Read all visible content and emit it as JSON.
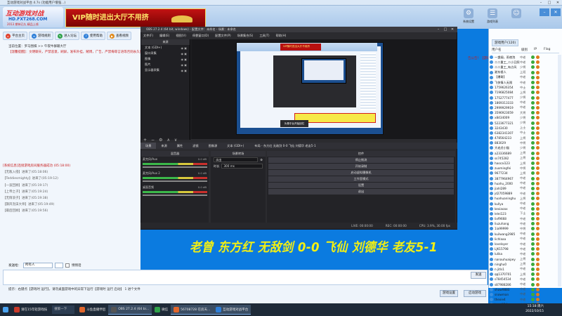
{
  "window": {
    "title": "互动游戏对战平台 4.7s (功能用户增强...)",
    "min": "–",
    "max": "□",
    "close": "✕"
  },
  "logo": {
    "line1": "互动游戏对战",
    "line2": "HD.FXT268.COM",
    "line3": "2013 期待已久 精品上线"
  },
  "vip_banner": "VIP随时进出大厅不用挤",
  "top_tools": [
    {
      "label": "系统设置",
      "icon": "gear-icon"
    },
    {
      "label": "游戏列表",
      "icon": "list-icon"
    },
    {
      "label": "",
      "icon": "user-icon"
    }
  ],
  "nav": [
    {
      "label": "平台主页",
      "color": "#e0402c",
      "icon": "home-icon"
    },
    {
      "label": "游戏规则",
      "color": "#2f7fd8",
      "icon": "rules-icon"
    },
    {
      "label": "进入论坛",
      "color": "#2fa24a",
      "icon": "forum-icon"
    },
    {
      "label": "使用帮助",
      "color": "#2f7fd8",
      "icon": "help-icon"
    },
    {
      "label": "查看视频",
      "color": "#e08a1c",
      "icon": "video-icon"
    }
  ],
  "breadcrumb": "当前位置：罗马围棋 >> 午夜牛群输大厅",
  "notice": "【温馨提醒】：文明聊天，严禁恶意，刷屏，发布外挂，赌博，广告，严禁侮辱言语等否则永久封号！",
  "notice_tail": "告公告！【游戏愉",
  "obs": {
    "title": "OBS 27.2.4 (64 bit, windows) - 配置文件：未命名 - 场景：未命名",
    "menu": [
      "文件(F)",
      "编辑(E)",
      "视图(V)",
      "停靠窗口(D)",
      "配置文件(P)",
      "场景集合(S)",
      "工具(T)",
      "帮助(H)"
    ],
    "scenes_header": "来源",
    "sources": [
      "文本 (GDI+)",
      "窗口采集",
      "图像",
      "图片",
      "显示器采集"
    ],
    "canvas_caption": "头像平台开始回忆",
    "tabs": [
      "场景",
      "来源"
    ],
    "controls_bar": [
      "属性",
      "滤镜",
      "图像源",
      "文本 (GDI+)"
    ],
    "source_desc": "布局 - 东方红 无敌剑 0-0 飞仙 刘德华 老友5-1",
    "mixer_header": "混音器",
    "channels": [
      {
        "name": "麦克风/Aux",
        "db": "0.0 dB"
      },
      {
        "name": "麦克风/Aux 2",
        "db": "0.0 dB"
      },
      {
        "name": "桌面音频",
        "db": "0.0 dB"
      }
    ],
    "transition_header": "场景转场",
    "transition_type": "淡出",
    "duration_label": "时长",
    "duration_value": "300 ms",
    "controls_header": "控件",
    "buttons": [
      "停止推流",
      "开始录制",
      "启动虚拟摄像机",
      "工作室模式",
      "设置",
      "退出"
    ],
    "status": [
      "LIVE: 00:00:00",
      "REC: 00:00:00",
      "CPU: 3.9%, 30.00 fps"
    ]
  },
  "chat": [
    {
      "text": "[系统信息]连接游戏房间服务器成功 (05:18:00)",
      "kind": "sys"
    },
    {
      "text": "【无敌入侵】进来了(05:18:06)",
      "kind": "msg"
    },
    {
      "text": "【Teddiesmighty】进来了(05:19:12)",
      "kind": "msg"
    },
    {
      "text": "【一波回顾】进来了(05:19:17)",
      "kind": "msg"
    },
    {
      "text": "【上帝之子】进来了(05:19:24)",
      "kind": "msg"
    },
    {
      "text": "【无情浪子】进来了(05:19:38)",
      "kind": "msg"
    },
    {
      "text": "【飘风泡沫大师】进来了(05:19:49)",
      "kind": "msg"
    },
    {
      "text": "【最后回顾】进来了(05:19:56)",
      "kind": "msg"
    }
  ],
  "overlay_text": "老曾 东方红 无敌剑 0-0 飞仙 刘德华 老友5-1",
  "send": {
    "label": "发送给：",
    "target": "所有人",
    "private_label": "悄悄话",
    "button": "发送"
  },
  "tip": "提示：右键点【游戏时 运行】，请勿桌面游戏中的异常下运行【游戏时 运行 启动】 1 进个文件",
  "footer_buttons": {
    "settings": "游戏设置",
    "start": "启动游戏"
  },
  "right_panel": {
    "tabs": [
      "游戏用户(120)"
    ],
    "cols": [
      "用户名",
      "级别",
      "IP",
      "Flag"
    ],
    "users": [
      {
        "name": "一盏烟，雨夜泡",
        "rank": "中老"
      },
      {
        "name": "二二重工_二小丑照",
        "rank": "中老"
      },
      {
        "name": "二二重工_有点风",
        "rank": "少将"
      },
      {
        "name": "湘东楼人",
        "rank": "上班"
      },
      {
        "name": "【爆哥】",
        "rank": "中老"
      },
      {
        "name": "飞侠情人无限",
        "rank": "中老"
      },
      {
        "name": "1759626354",
        "rank": "中士"
      },
      {
        "name": "7196825084",
        "rank": "上将"
      },
      {
        "name": "1752777477",
        "rank": "少将"
      },
      {
        "name": "1869313333",
        "rank": "中老"
      },
      {
        "name": "2999929919",
        "rank": "中老"
      },
      {
        "name": "3596923059",
        "rank": "大将"
      },
      {
        "name": "x8434009",
        "rank": "少将"
      },
      {
        "name": "5223677321",
        "rank": "少将"
      },
      {
        "name": "3243430",
        "rank": "上士"
      },
      {
        "name": "6382341307",
        "rank": "中士"
      },
      {
        "name": "478564233",
        "rank": "上将"
      },
      {
        "name": "883029",
        "rank": "中将"
      },
      {
        "name": "大老虎小猫",
        "rank": "少将"
      },
      {
        "name": "a23336689",
        "rank": "上将"
      },
      {
        "name": "ss745282",
        "rank": "上将"
      },
      {
        "name": "haocai123",
        "rank": "上将"
      },
      {
        "name": "zuomingfei",
        "rank": "中将"
      },
      {
        "name": "9677234",
        "rank": "上将"
      },
      {
        "name": "3877964967",
        "rank": "中老"
      },
      {
        "name": "huahu_2000",
        "rank": "中老"
      },
      {
        "name": "jiahl289",
        "rank": "中老"
      },
      {
        "name": "jd27059889",
        "rank": "中老"
      },
      {
        "name": "huahuaninghu",
        "rank": "上将"
      },
      {
        "name": "kullya",
        "rank": "中老"
      },
      {
        "name": "kexiaoax",
        "rank": "中老"
      },
      {
        "name": "lelei123",
        "rank": "下士"
      },
      {
        "name": "lixf9668",
        "rank": "中老"
      },
      {
        "name": "liuzuhang",
        "rank": "中老"
      },
      {
        "name": "1ia99999",
        "rank": "中将"
      },
      {
        "name": "kuilwang2985",
        "rank": "中老"
      },
      {
        "name": "lichlaaa",
        "rank": "中老"
      },
      {
        "name": "loveloyer",
        "rank": "中老"
      },
      {
        "name": "LJK15798",
        "rank": "中老"
      },
      {
        "name": "lulika",
        "rank": "中老"
      },
      {
        "name": "nanauhuaipey",
        "rank": "上将"
      },
      {
        "name": "ninghu0",
        "rank": "上将"
      },
      {
        "name": "n jitls1",
        "rank": "中老"
      },
      {
        "name": "qq1370701",
        "rank": "上将"
      },
      {
        "name": "s78454534",
        "rank": "中老"
      },
      {
        "name": "s87988286",
        "rank": "中老"
      },
      {
        "name": "shaw9880",
        "rank": "中老"
      },
      {
        "name": "snowman",
        "rank": "中老"
      },
      {
        "name": "thexie4",
        "rank": "中老"
      },
      {
        "name": "tuzui024",
        "rank": "中老"
      }
    ]
  },
  "taskbar": {
    "search": "搜索一下",
    "items": [
      {
        "label": "请在15年轻游戏技",
        "color": "#c93a2a"
      },
      {
        "label": "斗鱼直播伴侣",
        "color": "#e0662c"
      },
      {
        "label": "OBS 27.2.4 (64 bi...",
        "color": "#333"
      },
      {
        "label": "微信",
        "color": "#2fa24a"
      },
      {
        "label": "56708728 在房天...",
        "color": "#e0662c"
      },
      {
        "label": "互动游戏对战平台",
        "color": "#2f7fd8"
      }
    ],
    "time": "15:18 周六",
    "date": "2022/10/15"
  },
  "colors": {
    "accent": "#0b7be0",
    "notice": "#c81c1c",
    "overlay": "#f3ef12"
  }
}
